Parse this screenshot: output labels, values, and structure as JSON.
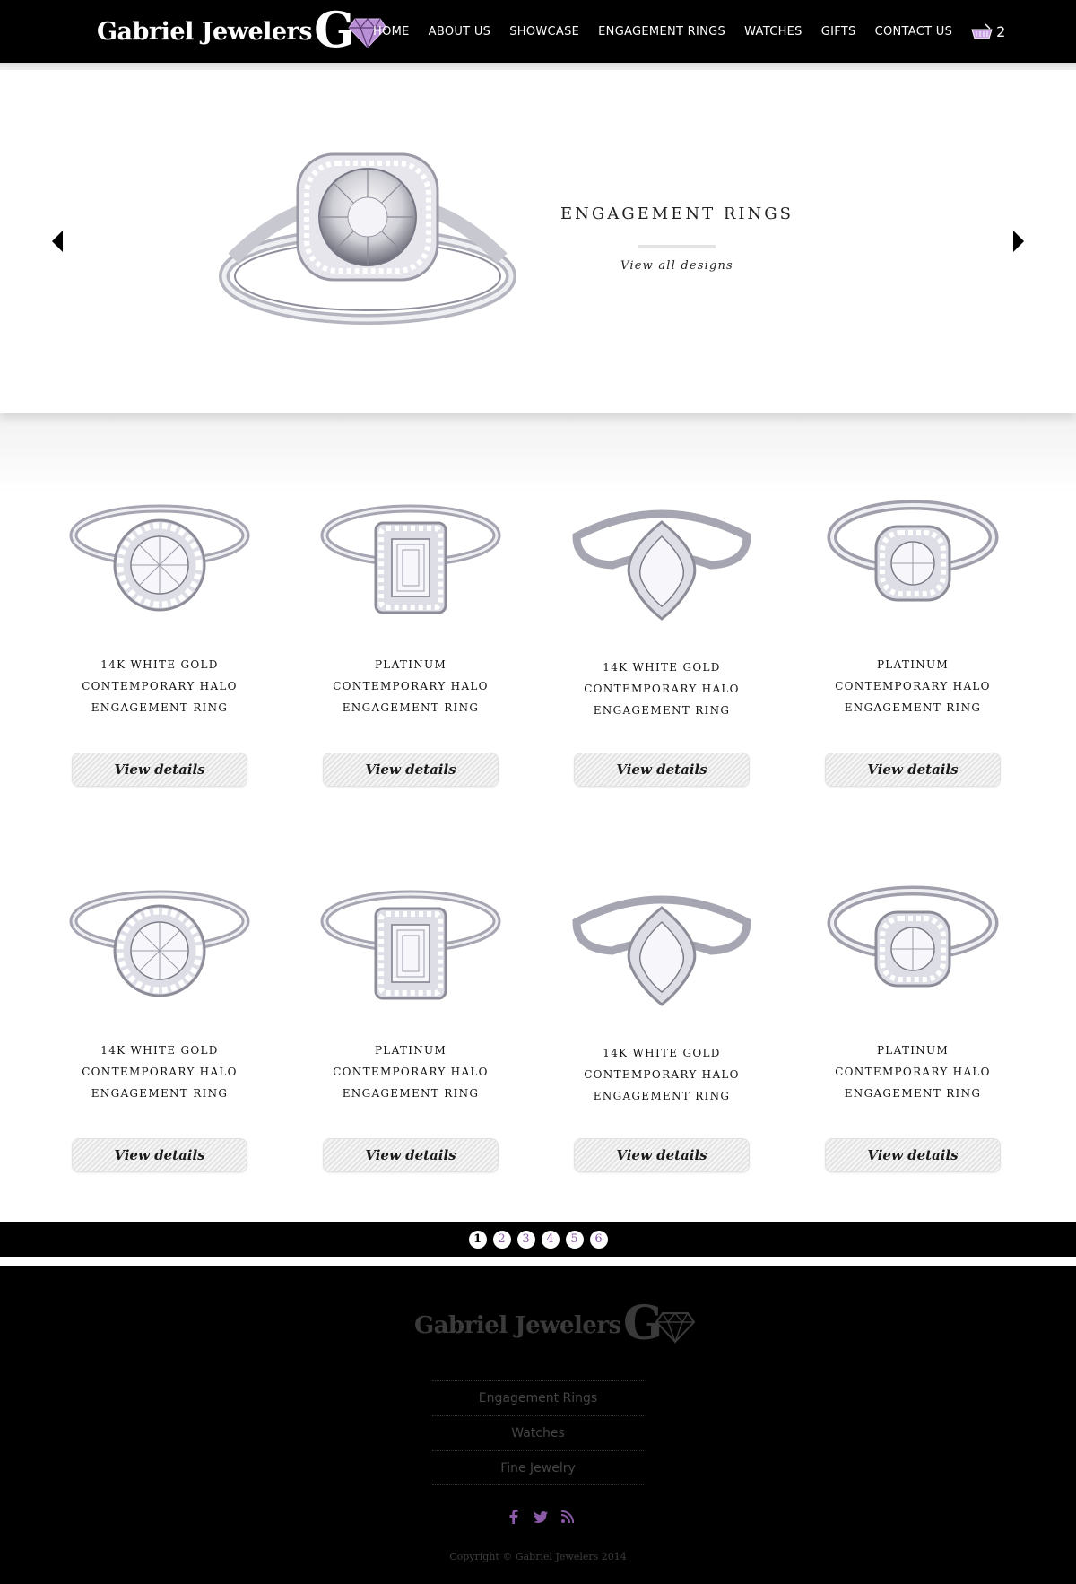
{
  "brand": {
    "name": "Gabriel Jewelers",
    "monogram": "G"
  },
  "nav": {
    "items": [
      "HOME",
      "ABOUT US",
      "SHOWCASE",
      "ENGAGEMENT RINGS",
      "WATCHES",
      "GIFTS",
      "CONTACT US"
    ],
    "cart_count": "2",
    "cart_icon": "shopping-basket-icon"
  },
  "hero": {
    "title": "ENGAGEMENT RINGS",
    "link": "View all designs",
    "prev_icon": "arrow-left-icon",
    "next_icon": "arrow-right-icon"
  },
  "products": [
    {
      "line1": "14K WHITE GOLD",
      "line2": "CONTEMPORARY HALO",
      "line3": "ENGAGEMENT RING",
      "button": "View details"
    },
    {
      "line1": "PLATINUM",
      "line2": "CONTEMPORARY HALO",
      "line3": "ENGAGEMENT RING",
      "button": "View details"
    },
    {
      "line1": "14K WHITE GOLD",
      "line2": "CONTEMPORARY HALO",
      "line3": "ENGAGEMENT RING",
      "button": "View details"
    },
    {
      "line1": "PLATINUM",
      "line2": "CONTEMPORARY HALO",
      "line3": "ENGAGEMENT RING",
      "button": "View details"
    },
    {
      "line1": "14K WHITE GOLD",
      "line2": "CONTEMPORARY HALO",
      "line3": "ENGAGEMENT RING",
      "button": "View details"
    },
    {
      "line1": "PLATINUM",
      "line2": "CONTEMPORARY HALO",
      "line3": "ENGAGEMENT RING",
      "button": "View details"
    },
    {
      "line1": "14K WHITE GOLD",
      "line2": "CONTEMPORARY HALO",
      "line3": "ENGAGEMENT RING",
      "button": "View details"
    },
    {
      "line1": "PLATINUM",
      "line2": "CONTEMPORARY HALO",
      "line3": "ENGAGEMENT RING",
      "button": "View details"
    }
  ],
  "pagination": {
    "pages": [
      "1",
      "2",
      "3",
      "4",
      "5",
      "6"
    ],
    "current": "1"
  },
  "footer": {
    "links": [
      "Engagement Rings",
      "Watches",
      "Fine Jewelry"
    ],
    "social_icons": [
      "facebook-icon",
      "twitter-icon",
      "rss-icon"
    ],
    "copyright": "Copyright © Gabriel Jewelers 2014"
  },
  "colors": {
    "header_bg": "#000000",
    "accent_purple": "#8a5aa6",
    "gem_purple": "#b98fd6",
    "footer_text": "#454545"
  }
}
